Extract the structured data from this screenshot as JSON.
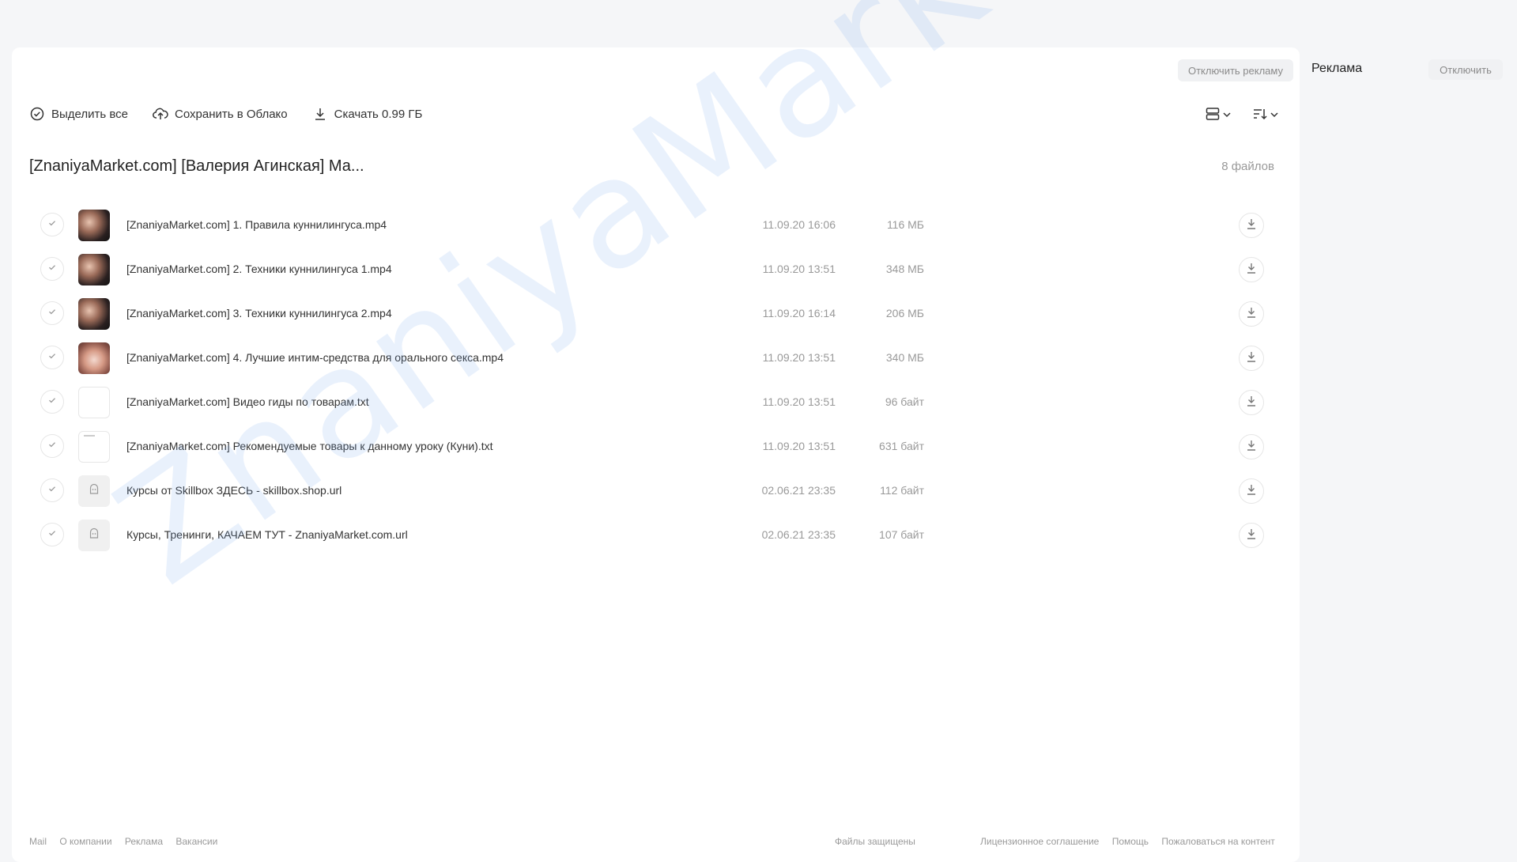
{
  "header": {
    "disable_ads_button": "Отключить рекламу"
  },
  "toolbar": {
    "select_all": "Выделить все",
    "save_to_cloud": "Сохранить в Облако",
    "download": "Скачать 0.99 ГБ"
  },
  "folder": {
    "title": "[ZnaniyaMarket.com] [Валерия Агинская] Ма...",
    "count": "8 файлов"
  },
  "files": [
    {
      "name": "[ZnaniyaMarket.com] 1. Правила куннилингуса.mp4",
      "date": "11.09.20 16:06",
      "size": "116 МБ",
      "type": "video"
    },
    {
      "name": "[ZnaniyaMarket.com] 2. Техники куннилингуса 1.mp4",
      "date": "11.09.20 13:51",
      "size": "348 МБ",
      "type": "video"
    },
    {
      "name": "[ZnaniyaMarket.com] 3. Техники куннилингуса 2.mp4",
      "date": "11.09.20 16:14",
      "size": "206 МБ",
      "type": "video"
    },
    {
      "name": "[ZnaniyaMarket.com] 4. Лучшие интим-средства для орального секса.mp4",
      "date": "11.09.20 13:51",
      "size": "340 МБ",
      "type": "video2"
    },
    {
      "name": "[ZnaniyaMarket.com] Видео гиды по товарам.txt",
      "date": "11.09.20 13:51",
      "size": "96 байт",
      "type": "txt"
    },
    {
      "name": "[ZnaniyaMarket.com] Рекомендуемые товары к данному уроку (Куни).txt",
      "date": "11.09.20 13:51",
      "size": "631 байт",
      "type": "txt2"
    },
    {
      "name": "Курсы от Skillbox ЗДЕСЬ - skillbox.shop.url",
      "date": "02.06.21 23:35",
      "size": "112 байт",
      "type": "url"
    },
    {
      "name": "Курсы, Тренинги, КАЧАЕМ ТУТ - ZnaniyaMarket.com.url",
      "date": "02.06.21 23:35",
      "size": "107 байт",
      "type": "url"
    }
  ],
  "sidebar": {
    "ad_title": "Реклама",
    "ad_disable": "Отключить"
  },
  "footer": {
    "left": [
      "Mail",
      "О компании",
      "Реклама",
      "Вакансии"
    ],
    "protected": "Файлы защищены",
    "right": [
      "Лицензионное соглашение",
      "Помощь",
      "Пожаловаться на контент"
    ]
  },
  "watermark": "ZnaniyaMarket.club",
  "colors": {
    "background": "#f5f6f8",
    "panel": "#ffffff",
    "watermark": "#78aaeb"
  }
}
